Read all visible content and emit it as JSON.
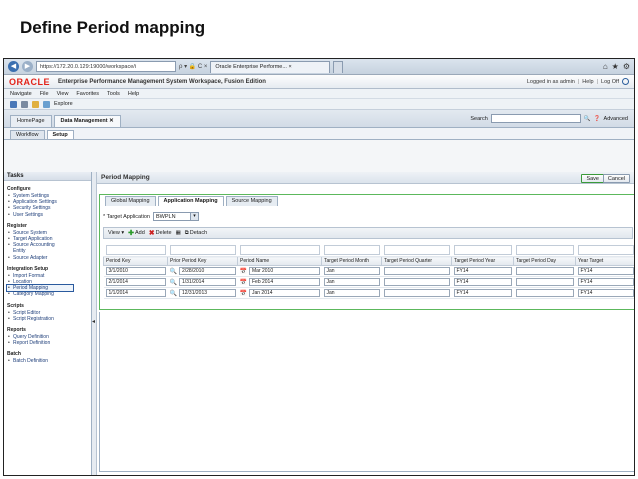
{
  "slide": {
    "title": "Define Period mapping"
  },
  "browser": {
    "address": "https://172.20.0.129:19000/workspace/i",
    "address_controls": "ρ ▾ 🔒 C ×",
    "tab_title": "Oracle Enterprise Performe...",
    "tab_close": "×"
  },
  "header": {
    "logo": "ORACLE",
    "app_title": "Enterprise Performance Management System Workspace, Fusion Edition",
    "logged_in": "Logged in as admin",
    "help": "Help",
    "logoff": "Log Off"
  },
  "menu": [
    "Navigate",
    "File",
    "View",
    "Favorites",
    "Tools",
    "Help"
  ],
  "toolbar": {
    "explore": "Explore"
  },
  "workspace_tabs": [
    {
      "label": "HomePage"
    },
    {
      "label": "Data Management"
    }
  ],
  "search": {
    "label": "Search",
    "advanced": "Advanced"
  },
  "wf_tabs": [
    "Workflow",
    "Setup"
  ],
  "tasks": {
    "title": "Tasks",
    "groups": [
      {
        "title": "Configure",
        "items": [
          "System Settings",
          "Application Settings",
          "Security Settings",
          "User Settings"
        ]
      },
      {
        "title": "Register",
        "items": [
          "Source System",
          "Target Application",
          "Source Accounting",
          "Entity",
          "Source Adapter"
        ]
      },
      {
        "title": "Integration Setup",
        "items": [
          "Import Format",
          "Location",
          "Period Mapping",
          "Category Mapping"
        ]
      },
      {
        "title": "Scripts",
        "items": [
          "Script Editor",
          "Script Registration"
        ]
      },
      {
        "title": "Reports",
        "items": [
          "Query Definition",
          "Report Definition"
        ]
      },
      {
        "title": "Batch",
        "items": [
          "Batch Definition"
        ]
      }
    ]
  },
  "main": {
    "title": "Period Mapping",
    "save": "Save",
    "cancel": "Cancel",
    "sub_tabs": [
      "Global Mapping",
      "Application Mapping",
      "Source Mapping"
    ],
    "target_label": "* Target Application",
    "target_value": "BWPLN",
    "grid_toolbar": {
      "view": "View ▾",
      "add": "Add",
      "delete": "Delete",
      "detach": "Detach"
    },
    "columns": [
      "Period Key",
      "Prior Period Key",
      "Period Name",
      "Target Period Month",
      "Target Period Quarter",
      "Target Period Year",
      "Target Period Day",
      "Year Target"
    ],
    "rows": [
      {
        "period_key": "3/1/2010",
        "prior_key": "2/28/2010",
        "period_name": "Mar 2010",
        "month": "Jan",
        "quarter": "",
        "year": "FY14",
        "day": "",
        "year_target": "FY14"
      },
      {
        "period_key": "2/1/2014",
        "prior_key": "1/31/2014",
        "period_name": "Feb 2014",
        "month": "Jan",
        "quarter": "",
        "year": "FY14",
        "day": "",
        "year_target": "FY14"
      },
      {
        "period_key": "1/1/2014",
        "prior_key": "12/31/2013",
        "period_name": "Jan 2014",
        "month": "Jan",
        "quarter": "",
        "year": "FY14",
        "day": "",
        "year_target": "FY14"
      }
    ]
  }
}
